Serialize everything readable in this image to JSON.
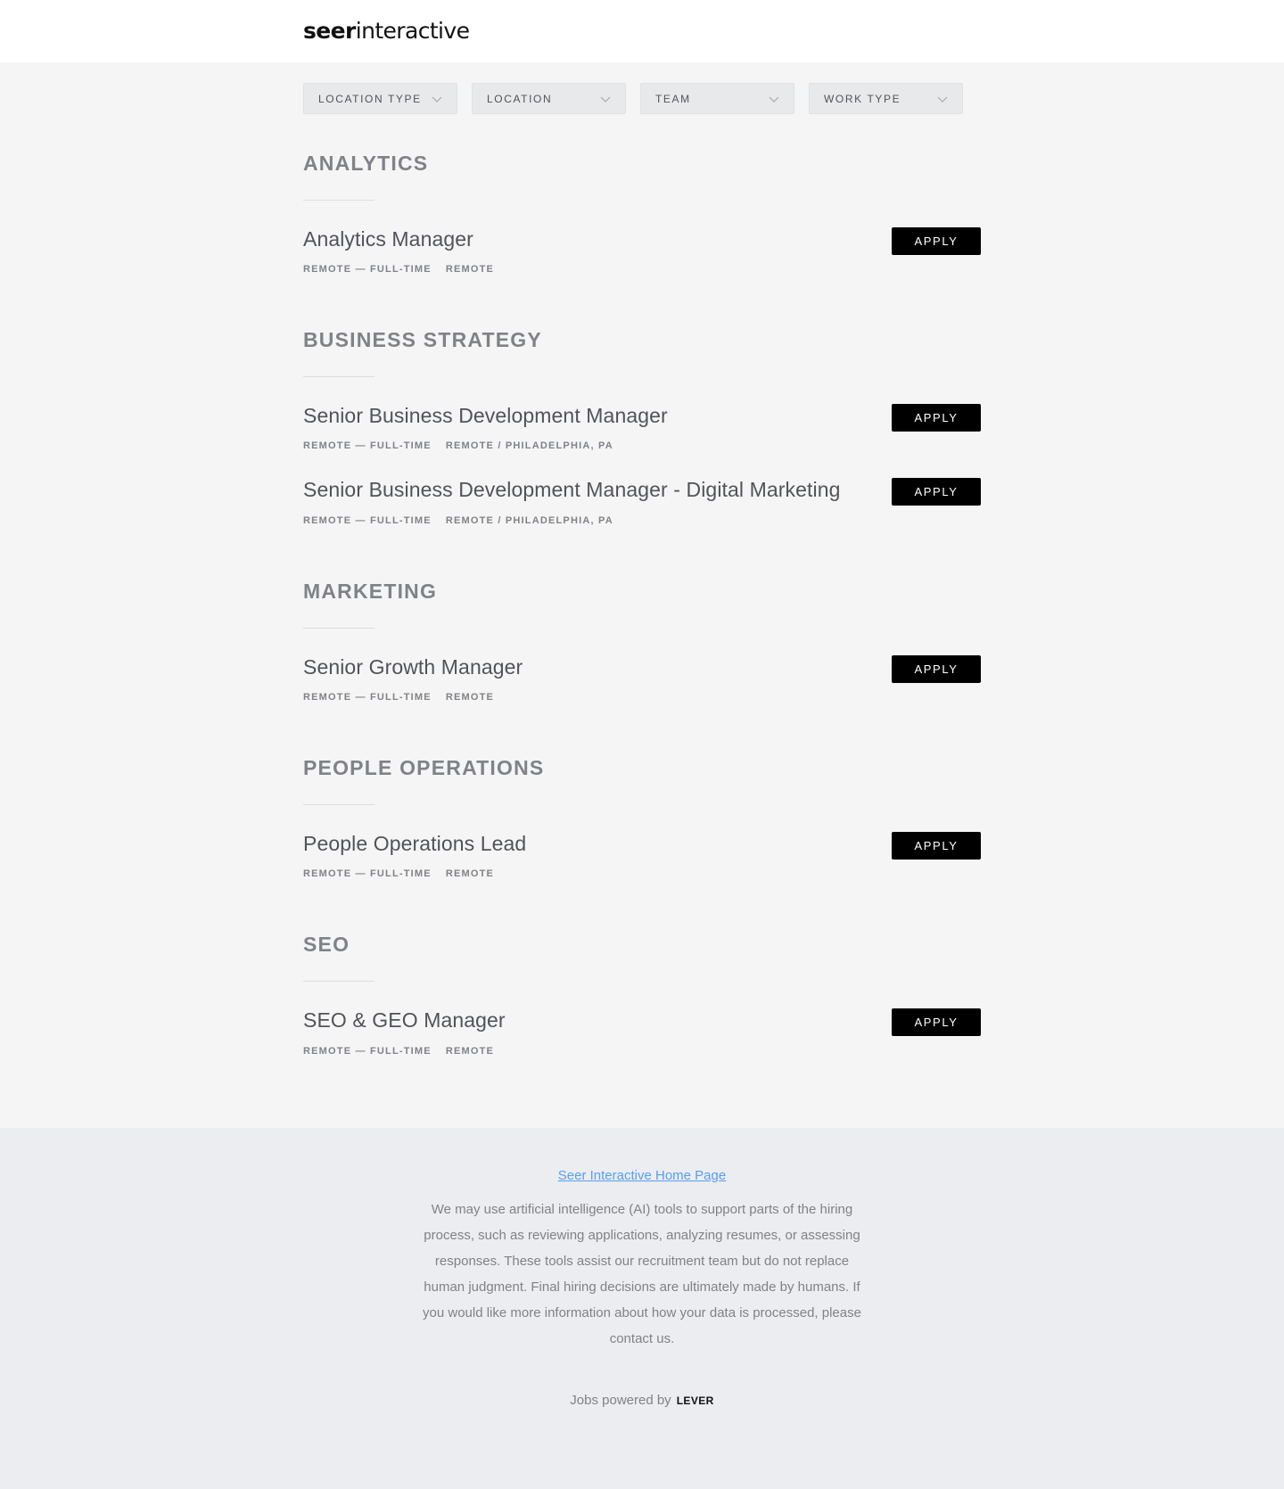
{
  "header": {
    "logo_bold": "seer",
    "logo_light": "interactive"
  },
  "filters": [
    {
      "label": "LOCATION TYPE"
    },
    {
      "label": "LOCATION"
    },
    {
      "label": "TEAM"
    },
    {
      "label": "WORK TYPE"
    }
  ],
  "groups": [
    {
      "title": "ANALYTICS",
      "postings": [
        {
          "title": "Analytics Manager",
          "commitment": "REMOTE — FULL-TIME",
          "location": "REMOTE",
          "apply": "APPLY"
        }
      ]
    },
    {
      "title": "BUSINESS STRATEGY",
      "postings": [
        {
          "title": "Senior Business Development Manager",
          "commitment": "REMOTE — FULL-TIME",
          "location": "REMOTE / PHILADELPHIA, PA",
          "apply": "APPLY"
        },
        {
          "title": "Senior Business Development Manager - Digital Marketing",
          "commitment": "REMOTE — FULL-TIME",
          "location": "REMOTE / PHILADELPHIA, PA",
          "apply": "APPLY"
        }
      ]
    },
    {
      "title": "MARKETING",
      "postings": [
        {
          "title": "Senior Growth Manager",
          "commitment": "REMOTE — FULL-TIME",
          "location": "REMOTE",
          "apply": "APPLY"
        }
      ]
    },
    {
      "title": "PEOPLE OPERATIONS",
      "postings": [
        {
          "title": "People Operations Lead",
          "commitment": "REMOTE — FULL-TIME",
          "location": "REMOTE",
          "apply": "APPLY"
        }
      ]
    },
    {
      "title": "SEO",
      "postings": [
        {
          "title": "SEO & GEO Manager",
          "commitment": "REMOTE — FULL-TIME",
          "location": "REMOTE",
          "apply": "APPLY"
        }
      ]
    }
  ],
  "footer": {
    "home_link": "Seer Interactive Home Page",
    "ai_notice": "We may use artificial intelligence (AI) tools to support parts of the hiring process, such as reviewing applications, analyzing resumes, or assessing responses. These tools assist our recruitment team but do not replace human judgment. Final hiring decisions are ultimately made by humans. If you would like more information about how your data is processed, please contact us.",
    "powered_by": "Jobs powered by",
    "lever": "LEVER"
  }
}
